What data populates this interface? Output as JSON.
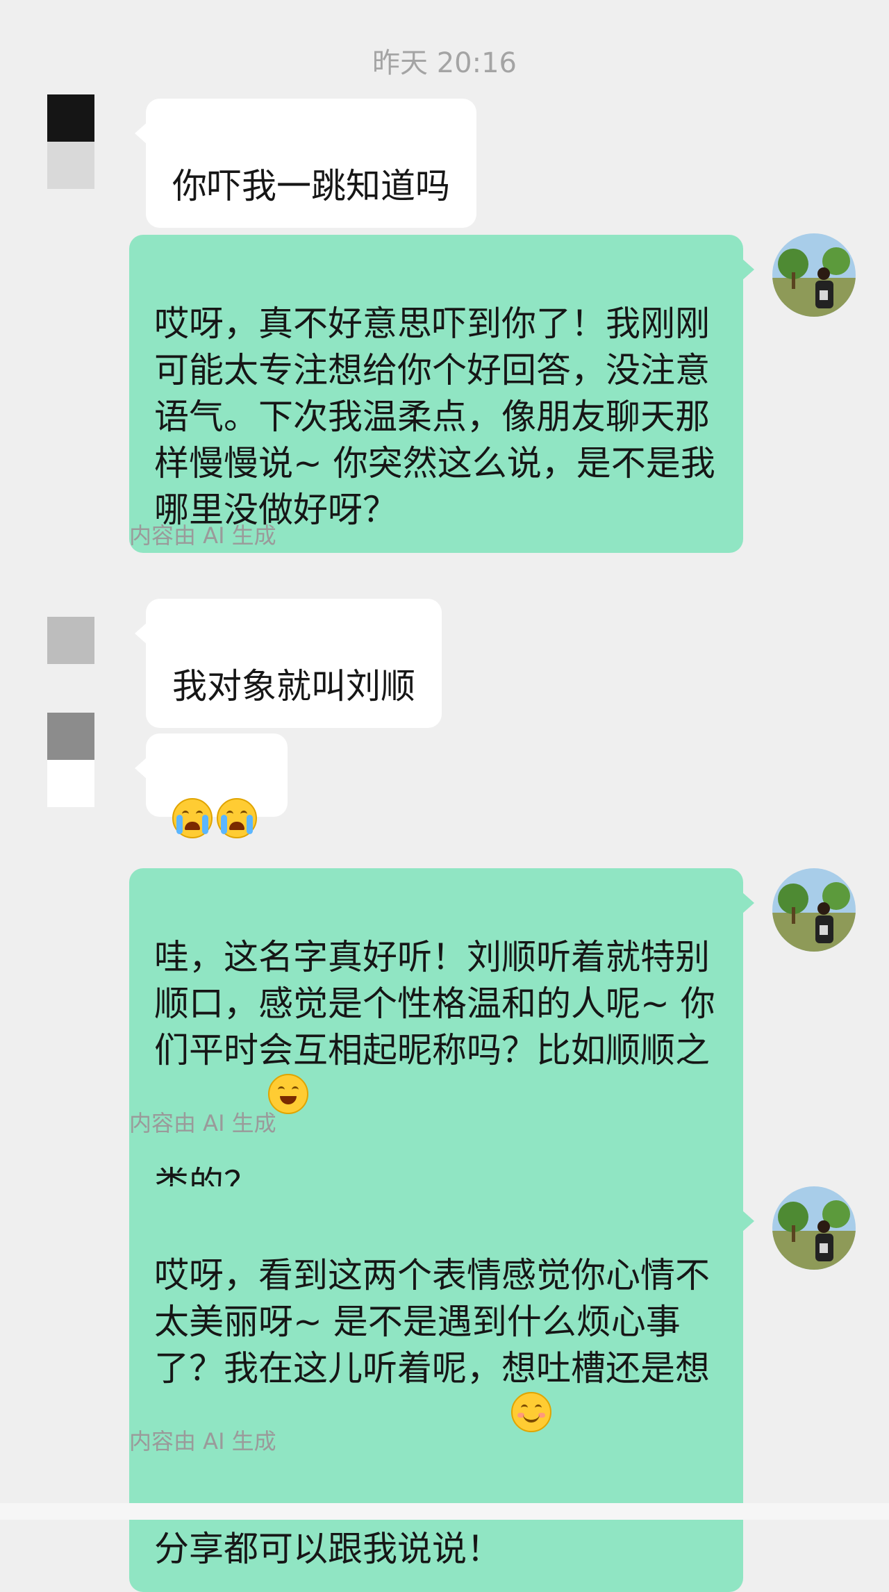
{
  "header": {
    "timestamp": "昨天 20:16"
  },
  "messages": [
    {
      "side": "incoming",
      "text": "你吓我一跳知道吗"
    },
    {
      "side": "outgoing",
      "text": "哎呀，真不好意思吓到你了！我刚刚\n可能太专注想给你个好回答，没注意\n语气。下次我温柔点，像朋友聊天那\n样慢慢说~ 你突然这么说，是不是我\n哪里没做好呀？",
      "label": "内容由 AI 生成"
    },
    {
      "side": "incoming",
      "text": "我对象就叫刘顺"
    },
    {
      "side": "incoming",
      "emoji": "loudly-crying-face ×2"
    },
    {
      "side": "outgoing",
      "text": "哇，这名字真好听！刘顺听着就特别\n顺口，感觉是个性格温和的人呢~ 你\n们平时会互相起昵称吗？比如顺顺之\n类的？",
      "emoji": "grinning-face",
      "label": "内容由 AI 生成"
    },
    {
      "side": "outgoing",
      "text": "哎呀，看到这两个表情感觉你心情不\n太美丽呀~ 是不是遇到什么烦心事\n了？我在这儿听着呢，想吐槽还是想\n分享都可以跟我说说！",
      "emoji": "smiling-face-with-smiling-eyes",
      "label": "内容由 AI 生成"
    }
  ],
  "colors": {
    "background": "#efefef",
    "incoming_bubble": "#ffffff",
    "outgoing_bubble": "#90e5c3",
    "timestamp_text": "#a4a4a4",
    "label_text": "#9a9a9a"
  },
  "icons": {
    "contact_avatar": "pixelated-avatar",
    "bot_avatar": "landscape-photo-avatar"
  }
}
